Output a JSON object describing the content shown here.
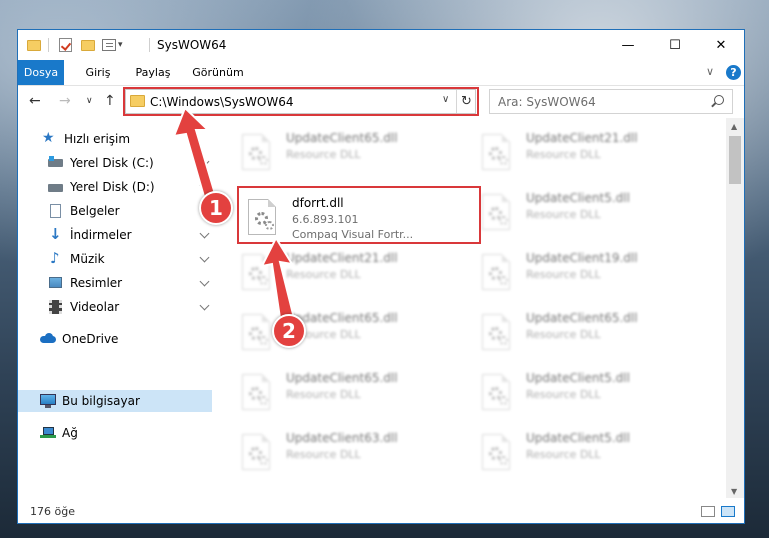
{
  "window": {
    "title": "SysWOW64",
    "minimize": "—",
    "maximize": "☐",
    "close": "✕"
  },
  "ribbon": {
    "tabs": [
      {
        "label": "Dosya",
        "active": true
      },
      {
        "label": "Giriş",
        "active": false
      },
      {
        "label": "Paylaş",
        "active": false
      },
      {
        "label": "Görünüm",
        "active": false
      }
    ],
    "collapse": "∨",
    "help": "?"
  },
  "nav": {
    "back": "←",
    "forward": "→",
    "recent": "∨",
    "up": "↑",
    "address": "C:\\Windows\\SysWOW64",
    "address_dropdown": "∨",
    "refresh": "↻",
    "search_placeholder": "Ara: SysWOW64"
  },
  "sidebar": {
    "items": [
      {
        "label": "Hızlı erişim",
        "icon": "star-icon",
        "pinned": false
      },
      {
        "label": "Yerel Disk (C:)",
        "icon": "drive-icon",
        "pinned": true
      },
      {
        "label": "Yerel Disk (D:)",
        "icon": "drive-icon",
        "pinned": true
      },
      {
        "label": "Belgeler",
        "icon": "documents-icon",
        "pinned": true
      },
      {
        "label": "İndirmeler",
        "icon": "download-icon",
        "pinned": true
      },
      {
        "label": "Müzik",
        "icon": "music-icon",
        "pinned": true
      },
      {
        "label": "Resimler",
        "icon": "pictures-icon",
        "pinned": true
      },
      {
        "label": "Videolar",
        "icon": "video-icon",
        "pinned": true
      },
      {
        "label": "OneDrive",
        "icon": "cloud-icon",
        "pinned": false
      },
      {
        "label": "Bu bilgisayar",
        "icon": "computer-icon",
        "pinned": false,
        "selected": true
      },
      {
        "label": "Ağ",
        "icon": "network-icon",
        "pinned": false
      }
    ]
  },
  "files": {
    "highlighted": {
      "name": "dforrt.dll",
      "version": "6.6.893.101",
      "company": "Compaq Visual Fortr..."
    },
    "background": [
      {
        "name": "UpdateClient65.dll",
        "desc": "Resource DLL"
      },
      {
        "name": "UpdateClient21.dll",
        "desc": "Resource DLL"
      },
      {
        "name": "UpdateClient5.dll",
        "desc": "Resource DLL"
      },
      {
        "name": "UpdateClient21.dll",
        "desc": "Resource DLL"
      },
      {
        "name": "UpdateClient19.dll",
        "desc": "Resource DLL"
      },
      {
        "name": "UpdateClient65.dll",
        "desc": "Resource DLL"
      },
      {
        "name": "UpdateClient65.dll",
        "desc": "Resource DLL"
      },
      {
        "name": "UpdateClient65.dll",
        "desc": "Resource DLL"
      },
      {
        "name": "UpdateClient5.dll",
        "desc": "Resource DLL"
      },
      {
        "name": "UpdateClient63.dll",
        "desc": "Resource DLL"
      },
      {
        "name": "UpdateClient5.dll",
        "desc": "Resource DLL"
      }
    ]
  },
  "status": {
    "count": "176 öğe"
  },
  "annotations": {
    "step1": "1",
    "step2": "2"
  },
  "colors": {
    "accent": "#1979ca",
    "highlight": "#d9383a",
    "selected": "#cce4f7"
  }
}
